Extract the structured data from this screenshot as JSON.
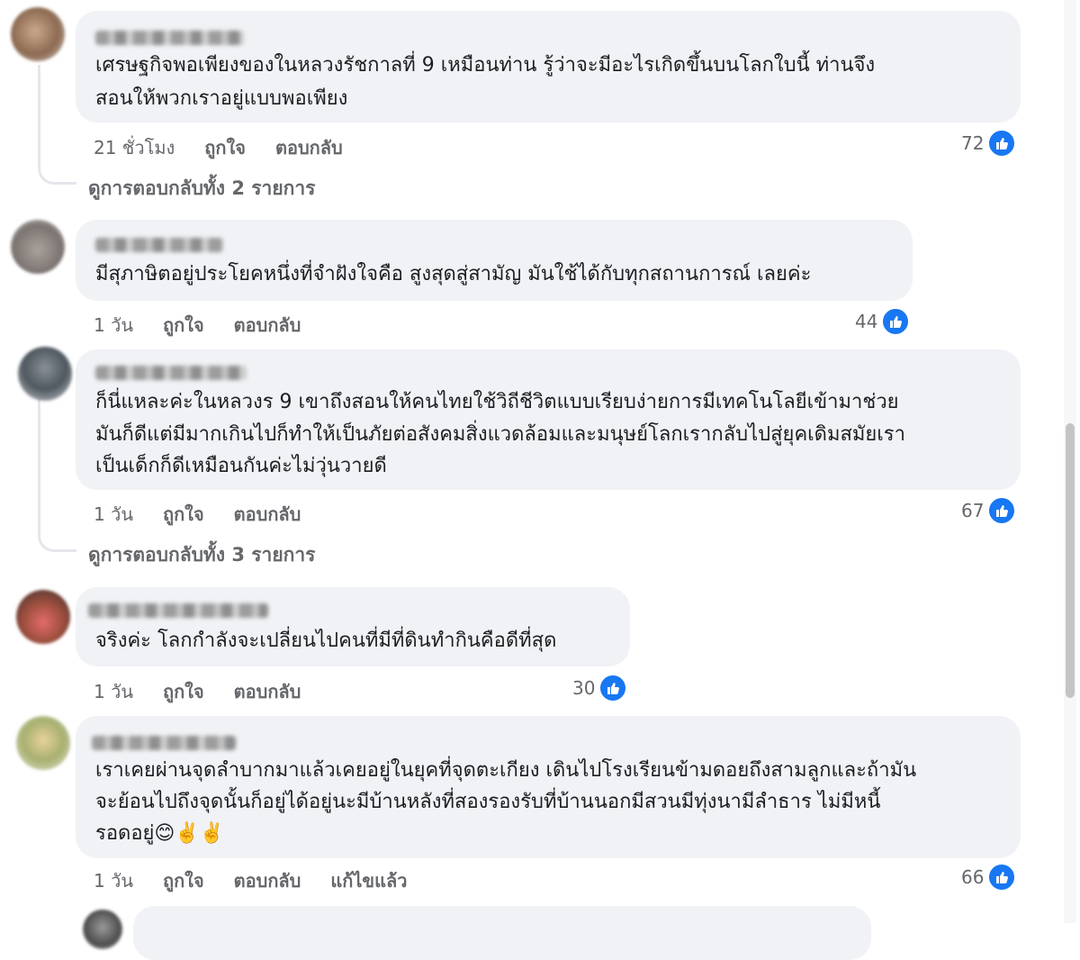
{
  "comments": [
    {
      "text_lines": [
        "เศรษฐกิจพอเพียงของในหลวงรัชกาลที่ 9 เหมือนท่าน รู้ว่าจะมีอะไรเกิดขึ้นบนโลกใบนี้ ท่านจึง",
        "สอนให้พวกเราอยู่แบบพอเพียง"
      ],
      "time": "21 ชั่วโมง",
      "like_label": "ถูกใจ",
      "reply_label": "ตอบกลับ",
      "likes": "72",
      "view_replies": "ดูการตอบกลับทั้ง 2 รายการ"
    },
    {
      "text_lines": [
        "มีสุภาษิตอยู่ประโยคหนึ่งที่จำฝังใจคือ สูงสุดสู่สามัญ มันใช้ได้กับทุกสถานการณ์ เลยค่ะ"
      ],
      "time": "1 วัน",
      "like_label": "ถูกใจ",
      "reply_label": "ตอบกลับ",
      "likes": "44"
    },
    {
      "text_lines": [
        "ก็นี่แหละค่ะในหลวงร 9 เขาถึงสอนให้คนไทยใช้วิถีชีวิตแบบเรียบง่ายการมีเทคโนโลยีเข้ามาช่วย",
        "มันก็ดีแต่มีมากเกินไปก็ทำให้เป็นภัยต่อสังคมสิ่งแวดล้อมและมนุษย์โลกเรากลับไปสู่ยุคเดิมสมัยเรา",
        "เป็นเด็กก็ดีเหมือนกันค่ะไม่วุ่นวายดี"
      ],
      "time": "1 วัน",
      "like_label": "ถูกใจ",
      "reply_label": "ตอบกลับ",
      "likes": "67",
      "view_replies": "ดูการตอบกลับทั้ง 3 รายการ"
    },
    {
      "text_lines": [
        "จริงค่ะ โลกกำลังจะเปลี่ยนไปคนที่มีที่ดินทำกินคือดีที่สุด"
      ],
      "time": "1 วัน",
      "like_label": "ถูกใจ",
      "reply_label": "ตอบกลับ",
      "likes": "30"
    },
    {
      "text_lines": [
        "เราเคยผ่านจุดลำบากมาแล้วเคยอยู่ในยุคที่จุดตะเกียง เดินไปโรงเรียนข้ามดอยถึงสามลูกและถ้ามัน",
        "จะย้อนไปถึงจุดนั้นก็อยู่ได้อยู่นะมีบ้านหลังที่สองรองรับที่บ้านนอกมีสวนมีทุ่งนามีลำธาร ไม่มีหนี้",
        "รอดอยู่😊✌️✌️"
      ],
      "time": "1 วัน",
      "like_label": "ถูกใจ",
      "reply_label": "ตอบกลับ",
      "edited_label": "แก้ไขแล้ว",
      "likes": "66"
    }
  ],
  "colors": {
    "bubble": "#f0f2f5",
    "meta": "#65676b",
    "like_blue": "#1877f2"
  },
  "icons": [
    "thumbs-up-icon"
  ]
}
